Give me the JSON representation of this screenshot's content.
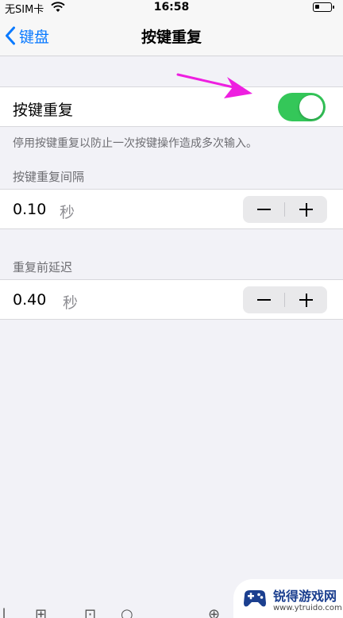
{
  "status_bar": {
    "carrier": "无SIM卡",
    "time": "16:58"
  },
  "nav": {
    "back_label": "键盘",
    "title": "按键重复"
  },
  "key_repeat": {
    "label": "按键重复",
    "enabled": true,
    "footnote": "停用按键重复以防止一次按键操作造成多次输入。"
  },
  "interval": {
    "header": "按键重复间隔",
    "value": "0.10",
    "unit": "秒"
  },
  "delay": {
    "header": "重复前延迟",
    "value": "0.40",
    "unit": "秒"
  },
  "watermark": {
    "title": "锐得游戏网",
    "url": "www.ytruido.com"
  },
  "colors": {
    "accent": "#0a7aff",
    "toggle_on": "#34c759",
    "arrow": "#ee1fe0"
  }
}
